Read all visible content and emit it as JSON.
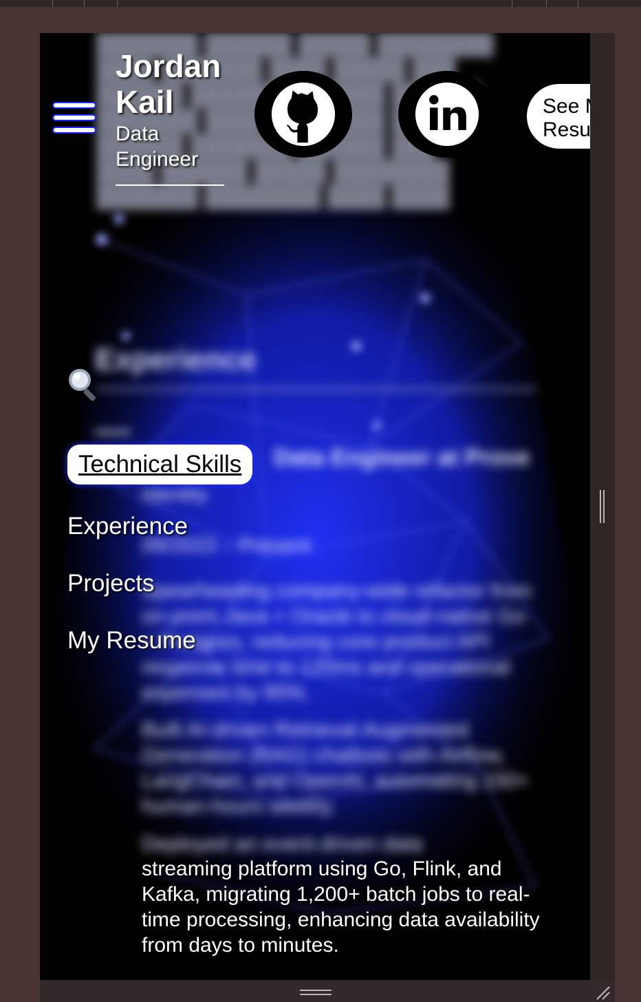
{
  "header": {
    "name_line1": "Jordan",
    "name_line2": "Kail",
    "role": "Data Engineer",
    "resume_button": "See My\nResume"
  },
  "social": [
    {
      "label": "GitHub",
      "icon": "github-icon"
    },
    {
      "label": "LinkedIn",
      "icon": "linkedin-icon"
    }
  ],
  "nav": {
    "search_icon": "search-icon",
    "items": [
      {
        "label": "Technical Skills",
        "active": true
      },
      {
        "label": "Experience",
        "active": false
      },
      {
        "label": "Projects",
        "active": false
      },
      {
        "label": "My Resume",
        "active": false
      }
    ]
  },
  "content": {
    "section_heading": "Experience",
    "job_title": "Data Engineer at Prove",
    "company": "Identity",
    "dates": "09/2023 – Present",
    "bullets": [
      "Spearheading company-wide refactor from on-prem Java + Oracle to cloud-native Go + Postgres, reducing core product API response time to 120ms and operational expenses by 95%.",
      "Built AI-driven Retrieval-Augmented Generation (RAG) chatbots with Airflow, LangChain, and OpenAI, automating 150+ human-hours weekly.",
      "Deployed an event-driven data",
      "streaming platform using Go, Flink, and Kafka, migrating 1,200+ batch jobs to real-time processing, enhancing data availability from days to minutes."
    ]
  },
  "colors": {
    "accent": "#1a24ff",
    "background": "#000000",
    "frame": "#4a3433"
  }
}
